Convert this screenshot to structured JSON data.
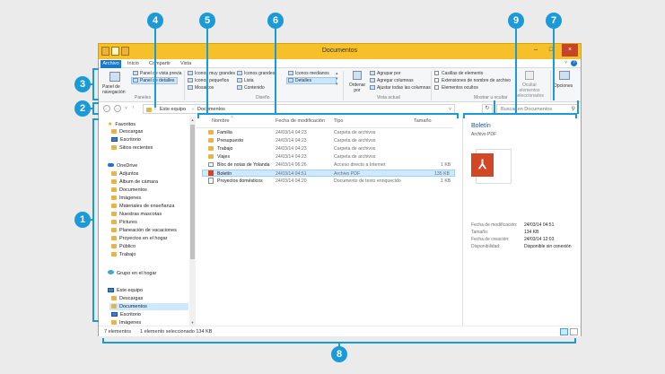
{
  "window": {
    "title": "Documentos"
  },
  "tabs": [
    "Archivo",
    "Inicio",
    "Compartir",
    "Vista"
  ],
  "ribbon": {
    "panes": {
      "nav_pane": "Panel de navegación",
      "preview": "Panel de vista previa",
      "details": "Panel de detalles",
      "label": "Paneles"
    },
    "layout": {
      "items": [
        "Iconos muy grandes",
        "Iconos grandes",
        "Iconos medianos",
        "Iconos pequeños",
        "Lista",
        "Detalles",
        "Mosaicos",
        "Contenido"
      ],
      "label": "Diseño"
    },
    "current_view": {
      "sort": "Ordenar por",
      "group": "Agrupar por",
      "add_columns": "Agregar columnas",
      "fit_columns": "Ajustar todas las columnas",
      "label": "Vista actual"
    },
    "show_hide": {
      "checkboxes": [
        "Casillas de elemento",
        "Extensiones de nombre de archivo",
        "Elementos ocultos"
      ],
      "hide_selected": "Ocultar elementos seleccionados",
      "label": "Mostrar u ocultar"
    },
    "options": "Opciones"
  },
  "address": {
    "crumbs": [
      "Este equipo",
      "Documentos"
    ],
    "search_placeholder": "Buscar en Documentos"
  },
  "nav": {
    "favorites": "Favoritos",
    "favorites_items": [
      "Descargas",
      "Escritorio",
      "Sitios recientes"
    ],
    "onedrive": "OneDrive",
    "onedrive_items": [
      "Adjuntos",
      "Álbum de cámara",
      "Documentos",
      "Imágenes",
      "Materiales de enseñanza",
      "Nuestras mascotas",
      "Pictures",
      "Planeación de vacaciones",
      "Proyectos en el hogar",
      "Público",
      "Trabajo"
    ],
    "homegroup": "Grupo en el hogar",
    "pc": "Este equipo",
    "pc_items": [
      "Descargas",
      "Documentos",
      "Escritorio",
      "Imágenes"
    ]
  },
  "columns": [
    "Nombre",
    "Fecha de modificación",
    "Tipo",
    "Tamaño"
  ],
  "files": [
    {
      "name": "Familia",
      "date": "24/03/14 04:23",
      "type": "Carpeta de archivos",
      "size": ""
    },
    {
      "name": "Presupuesto",
      "date": "24/03/14 04:23",
      "type": "Carpeta de archivos",
      "size": ""
    },
    {
      "name": "Trabajo",
      "date": "24/03/14 04:23",
      "type": "Carpeta de archivos",
      "size": ""
    },
    {
      "name": "Viajes",
      "date": "24/03/14 04:23",
      "type": "Carpeta de archivos",
      "size": ""
    },
    {
      "name": "Bloc de notas de Yolanda",
      "date": "24/03/14 06:26",
      "type": "Acceso directo a Internet",
      "size": "1 KB"
    },
    {
      "name": "Boletín",
      "date": "24/03/14 04:51",
      "type": "Archivo PDF",
      "size": "135 KB"
    },
    {
      "name": "Proyectos domésticos",
      "date": "24/03/14 04:20",
      "type": "Documento de texto enriquecido",
      "size": "1 KB"
    }
  ],
  "preview": {
    "title": "Boletín",
    "subtitle": "Archivo PDF",
    "props": [
      {
        "k": "Fecha de modificación:",
        "v": "24/03/14 04:51"
      },
      {
        "k": "Tamaño:",
        "v": "134 KB"
      },
      {
        "k": "Fecha de creación:",
        "v": "24/03/14 12:03"
      },
      {
        "k": "Disponibilidad:",
        "v": "Disponible sin conexión"
      }
    ]
  },
  "status": {
    "count": "7 elementos",
    "selected": "1 elemento seleccionado  134 KB"
  },
  "callouts": [
    "1",
    "2",
    "3",
    "4",
    "5",
    "6",
    "7",
    "8",
    "9"
  ],
  "colors": {
    "accent": "#1a9ad7",
    "titlebar": "#f6c02b",
    "file_tab": "#1979ca",
    "selection": "#cde8ff"
  }
}
